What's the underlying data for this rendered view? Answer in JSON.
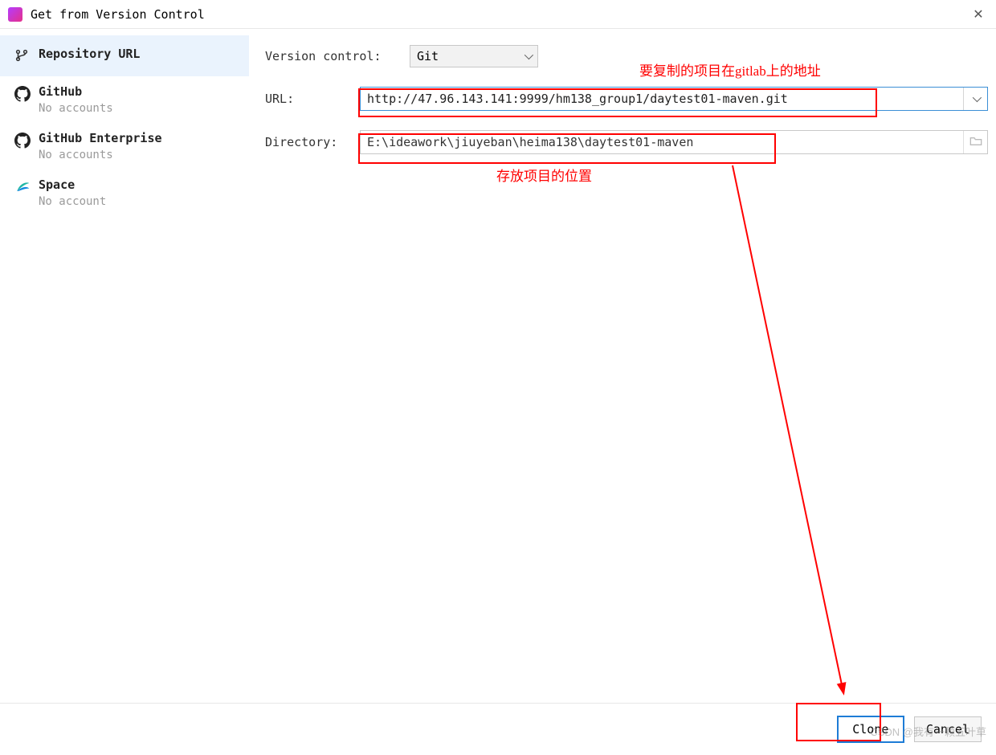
{
  "window": {
    "title": "Get from Version Control"
  },
  "sidebar": {
    "items": [
      {
        "label": "Repository URL",
        "sub": ""
      },
      {
        "label": "GitHub",
        "sub": "No accounts"
      },
      {
        "label": "GitHub Enterprise",
        "sub": "No accounts"
      },
      {
        "label": "Space",
        "sub": "No account"
      }
    ]
  },
  "form": {
    "version_control_label": "Version control:",
    "version_control_value": "Git",
    "url_label": "URL:",
    "url_value": "http://47.96.143.141:9999/hm138_group1/daytest01-maven.git",
    "directory_label": "Directory:",
    "directory_value": "E:\\ideawork\\jiuyeban\\heima138\\daytest01-maven"
  },
  "annotations": {
    "gitlab_note": "要复制的项目在gitlab上的地址",
    "dir_note": "存放项目的位置"
  },
  "footer": {
    "clone": "Clone",
    "cancel": "Cancel"
  },
  "watermark": "CSDN @我有一颗五叶草"
}
